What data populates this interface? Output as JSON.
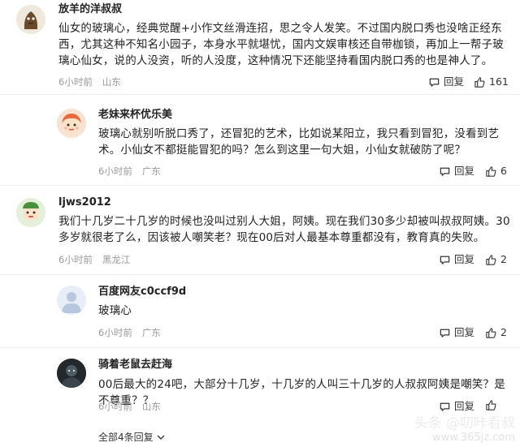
{
  "comments": [
    {
      "username": "放羊的洋叔叔",
      "text": "仙女的玻璃心，经典觉醒+小作文丝滑连招，思之令人发笑。不过国内脱口秀也没啥正经东西，尤其这种不知名小园子，本身水平就堪忧，国内文娱审核还自带枷锁，再加上一帮子玻璃心仙女，说的人没资，听的人没度，这种情况下还能坚持看国内脱口秀的也是神人了。",
      "time": "6小时前",
      "location": "山东",
      "reply_label": "回复",
      "likes": "161",
      "avatar_icon": "brown-figure-avatar-icon"
    },
    {
      "username": "老妹来杯优乐美",
      "text": "玻璃心就别听脱口秀了，还冒犯的艺术，比如说某阳立，我只看到冒犯，没看到艺术。小仙女不都挺能冒犯的吗？怎么到这里一句大姐，小仙女就破防了呢？",
      "time": "6小时前",
      "location": "广东",
      "reply_label": "回复",
      "likes": "6",
      "avatar_icon": "cartoon-girl-avatar-icon"
    },
    {
      "username": "ljws2012",
      "text": "我们十几岁二十几岁的时候也没叫过别人大姐，阿姨。现在我们30多少却被叫叔叔阿姨。30多岁就很老了么，因该被人嘲笑老？现在00后对人最基本尊重都没有，教育真的失败。",
      "time": "6小时前",
      "location": "黑龙江",
      "reply_label": "回复",
      "likes": "2",
      "avatar_icon": "cartoon-boy-avatar-icon"
    },
    {
      "username": "百度网友c0ccf9d",
      "text": "玻璃心",
      "time": "6小时前",
      "location": "广东",
      "reply_label": "回复",
      "likes": "2",
      "avatar_icon": "default-user-avatar-icon"
    },
    {
      "username": "骑着老鼠去赶海",
      "text": "00后最大的24吧，大部分十几岁，十几岁的人叫三十几岁的人叔叔阿姨是嘲笑？是不尊重？？",
      "time": "6小时前",
      "location": "山东",
      "reply_label": "回复",
      "likes": "",
      "avatar_icon": "dark-figure-avatar-icon"
    }
  ],
  "footer": {
    "all_replies": "全部4条回复"
  },
  "watermark": {
    "line1": "头条 @叨咔看叔",
    "line2": "www.365jz.com"
  }
}
